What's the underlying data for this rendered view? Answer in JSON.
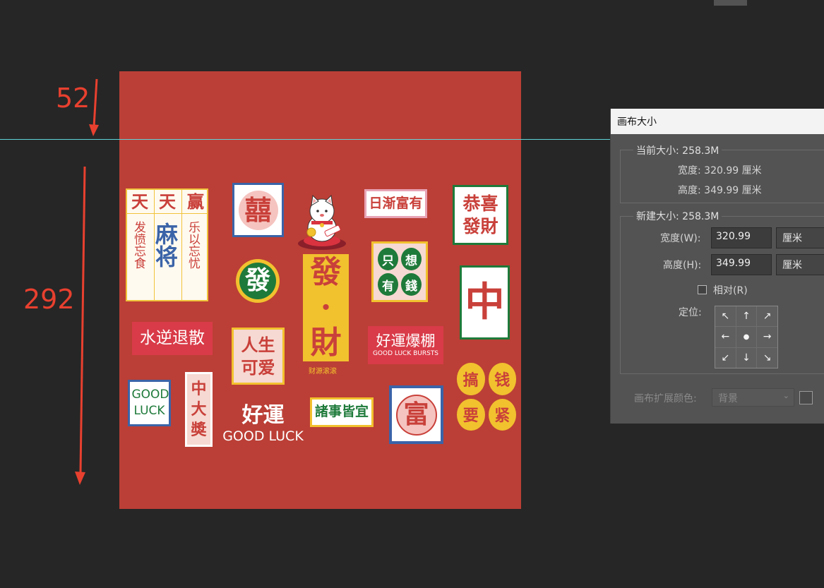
{
  "annotations": {
    "top_offset": "52",
    "height_value": "292"
  },
  "stickers": {
    "tiantian": {
      "col1_head": "天",
      "col2_head": "天",
      "col3_head": "赢",
      "left_text": "发愤忘食",
      "center_text": "麻将",
      "right_text": "乐以忘忧"
    },
    "xi": "囍",
    "cat_label": "招财猫",
    "rijian": "日渐富有",
    "gongxi": "恭喜發財",
    "fa_round": "發",
    "facai_big": "發·財",
    "facai_sub": "财源滚滚",
    "zhixiang": [
      "只",
      "想",
      "有",
      "錢"
    ],
    "zhong": "中",
    "shuini": "水逆退散",
    "rensheng": "人生可爱",
    "haoyun_bp": "好運爆棚",
    "haoyun_bp_en": "GOOD LUCK BURSTS",
    "goodluck_card": "GOOD LUCK",
    "zhongdajiang": "中大奬",
    "haoyun": "好運",
    "haoyun_en": "GOOD LUCK",
    "zhushi": "諸事皆宜",
    "fu": "富",
    "gaoqian": [
      "搞",
      "钱",
      "要",
      "紧"
    ]
  },
  "dialog": {
    "title": "画布大小",
    "current": {
      "legend": "当前大小: 258.3M",
      "width_row": "宽度:  320.99 厘米",
      "height_row": "高度:  349.99 厘米"
    },
    "new": {
      "legend": "新建大小: 258.3M",
      "width_label": "宽度(W):",
      "width_value": "320.99",
      "width_unit": "厘米",
      "height_label": "高度(H):",
      "height_value": "349.99",
      "height_unit": "厘米",
      "relative_label": "相对(R)",
      "anchor_label": "定位:"
    },
    "anchor_arrows": [
      "↖",
      "↑",
      "↗",
      "←",
      "●",
      "→",
      "↙",
      "↓",
      "↘"
    ],
    "ext_color_label": "画布扩展颜色:",
    "ext_color_value": "背景"
  },
  "colors": {
    "canvas_red": "#bb3f36",
    "guide_cyan": "#5fd3d8",
    "annotation_red": "#e8402f"
  }
}
